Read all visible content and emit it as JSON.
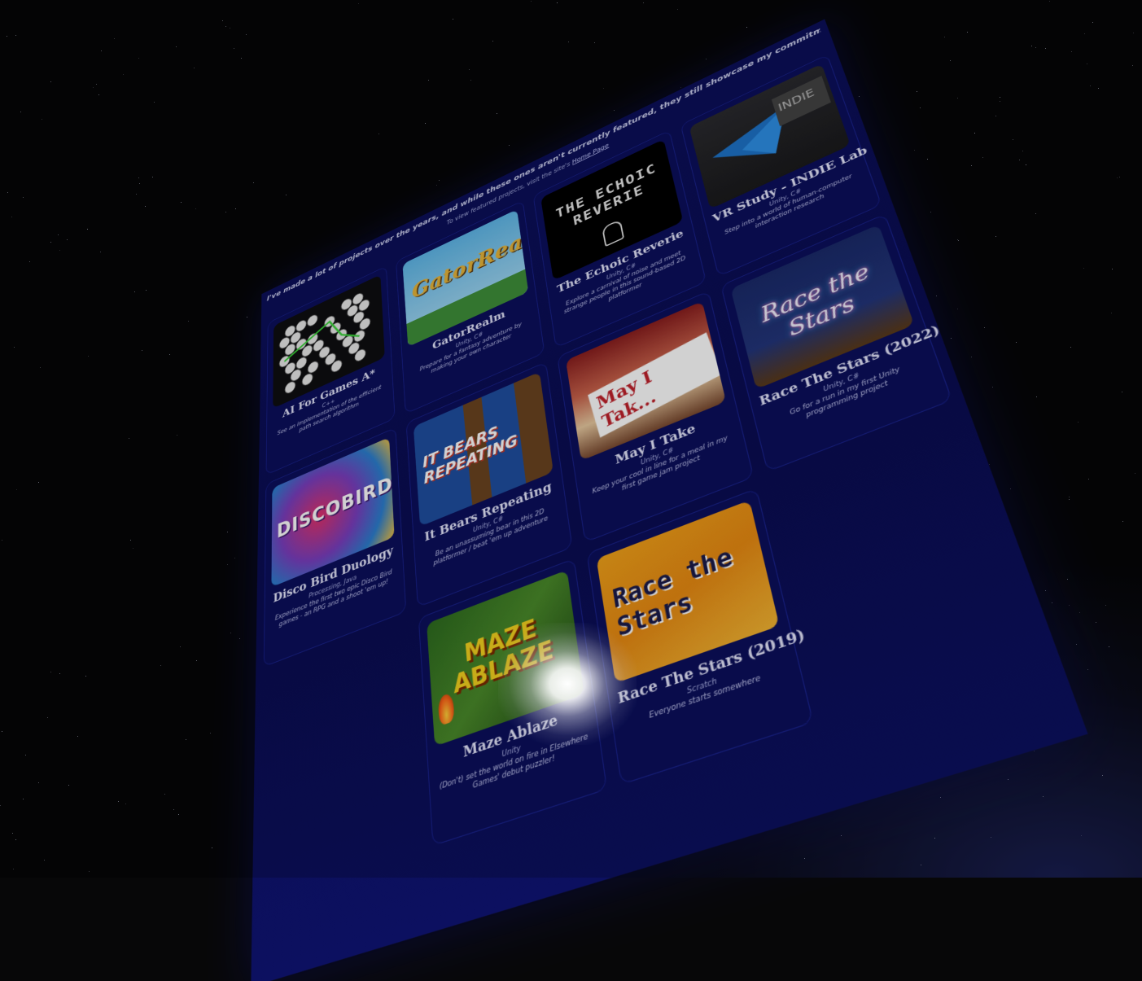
{
  "intro": {
    "text": "I've made a lot of projects over the years, and while these ones aren't currently featured, they still showcase my commitment to the art of game programming and development in different ways",
    "view_featured": "To view featured projects, visit the site's",
    "home_link": "Home Page"
  },
  "projects": [
    {
      "title": "AI For Games A*",
      "tech": "C++",
      "desc": "See an implementation of the efficient path search algorithm",
      "thumb": "hex-grid"
    },
    {
      "title": "GatorRealm",
      "tech": "Unity, C#",
      "desc": "Prepare for a fantasy adventure by making your own character",
      "thumb": "gator",
      "art": "GatorRealm"
    },
    {
      "title": "The Echoic Reverie",
      "tech": "Unity, C#",
      "desc": "Explore a carnival of noise and meet strange people in this sound-based 2D platformer",
      "thumb": "echoic",
      "art": "THE ECHOIC REVERIE"
    },
    {
      "title": "VR Study - INDIE Lab",
      "tech": "Unity, C#",
      "desc": "Step into a world of human-computer interaction research",
      "thumb": "indie",
      "art": "INDIE"
    },
    {
      "title": "Disco Bird Duology",
      "tech": "Processing, Java",
      "desc": "Experience the first two epic Disco Bird games - an RPG and a shoot 'em up!",
      "thumb": "disco",
      "art": "DISCOBIRD"
    },
    {
      "title": "It Bears Repeating",
      "tech": "Unity, C#",
      "desc": "Be an unassuming bear in this 2D platformer / beat 'em up adventure",
      "thumb": "bears",
      "art": "IT BEARS REPEATING"
    },
    {
      "title": "May I Take",
      "tech": "Unity, C#",
      "desc": "Keep your cool in line for a meal in my first game jam project",
      "thumb": "may",
      "art": "May I Tak..."
    },
    {
      "title": "Race The Stars (2022)",
      "tech": "Unity, C#",
      "desc": "Go for a run in my first Unity programming project",
      "thumb": "race22",
      "art": "Race the Stars"
    },
    {
      "title": "Maze Ablaze",
      "tech": "Unity",
      "desc": "(Don't) set the world on fire in Elsewhere Games' debut puzzler!",
      "thumb": "maze",
      "art": "MAZE ABLAZE"
    },
    {
      "title": "Race The Stars (2019)",
      "tech": "Scratch",
      "desc": "Everyone starts somewhere",
      "thumb": "race19",
      "art": "Race the Stars"
    }
  ],
  "colors": {
    "board": "#0b0f5a",
    "card_border": "#1a238f",
    "title": "#e8e9ff"
  }
}
